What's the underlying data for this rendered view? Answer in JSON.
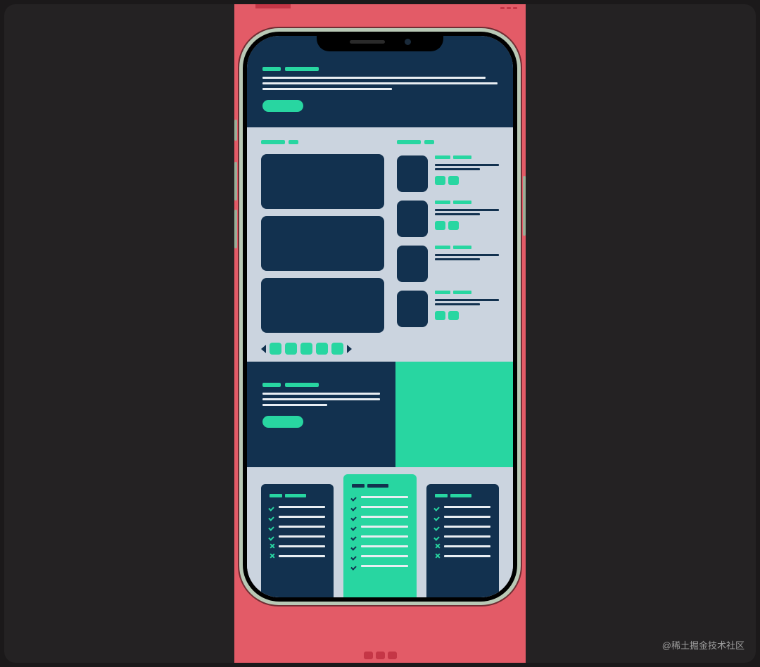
{
  "watermark": "@稀土掘金技术社区",
  "colors": {
    "navy": "#12314f",
    "teal": "#28d6a1",
    "grey": "#cbd4df",
    "page_bg": "#e35b67"
  },
  "device": "iPhone 12",
  "wireframe": {
    "hero": {
      "title_words": 2,
      "text_lines": 3,
      "has_cta": true
    },
    "gallery": {
      "large_cards": 3,
      "pager_items": 5
    },
    "list_items": [
      {
        "chips": 2
      },
      {
        "chips": 2
      },
      {
        "chips": 0
      },
      {
        "chips": 2
      }
    ],
    "split_banner": {
      "left_text_lines": 3,
      "has_cta": true
    },
    "pricing": {
      "plans": [
        {
          "variant": "dark",
          "features": [
            "ok",
            "ok",
            "ok",
            "ok",
            "no",
            "no"
          ]
        },
        {
          "variant": "teal",
          "features": [
            "ok",
            "ok",
            "ok",
            "ok",
            "ok",
            "ok",
            "ok",
            "ok"
          ]
        },
        {
          "variant": "dark",
          "features": [
            "ok",
            "ok",
            "ok",
            "ok",
            "no",
            "no"
          ]
        }
      ]
    }
  }
}
